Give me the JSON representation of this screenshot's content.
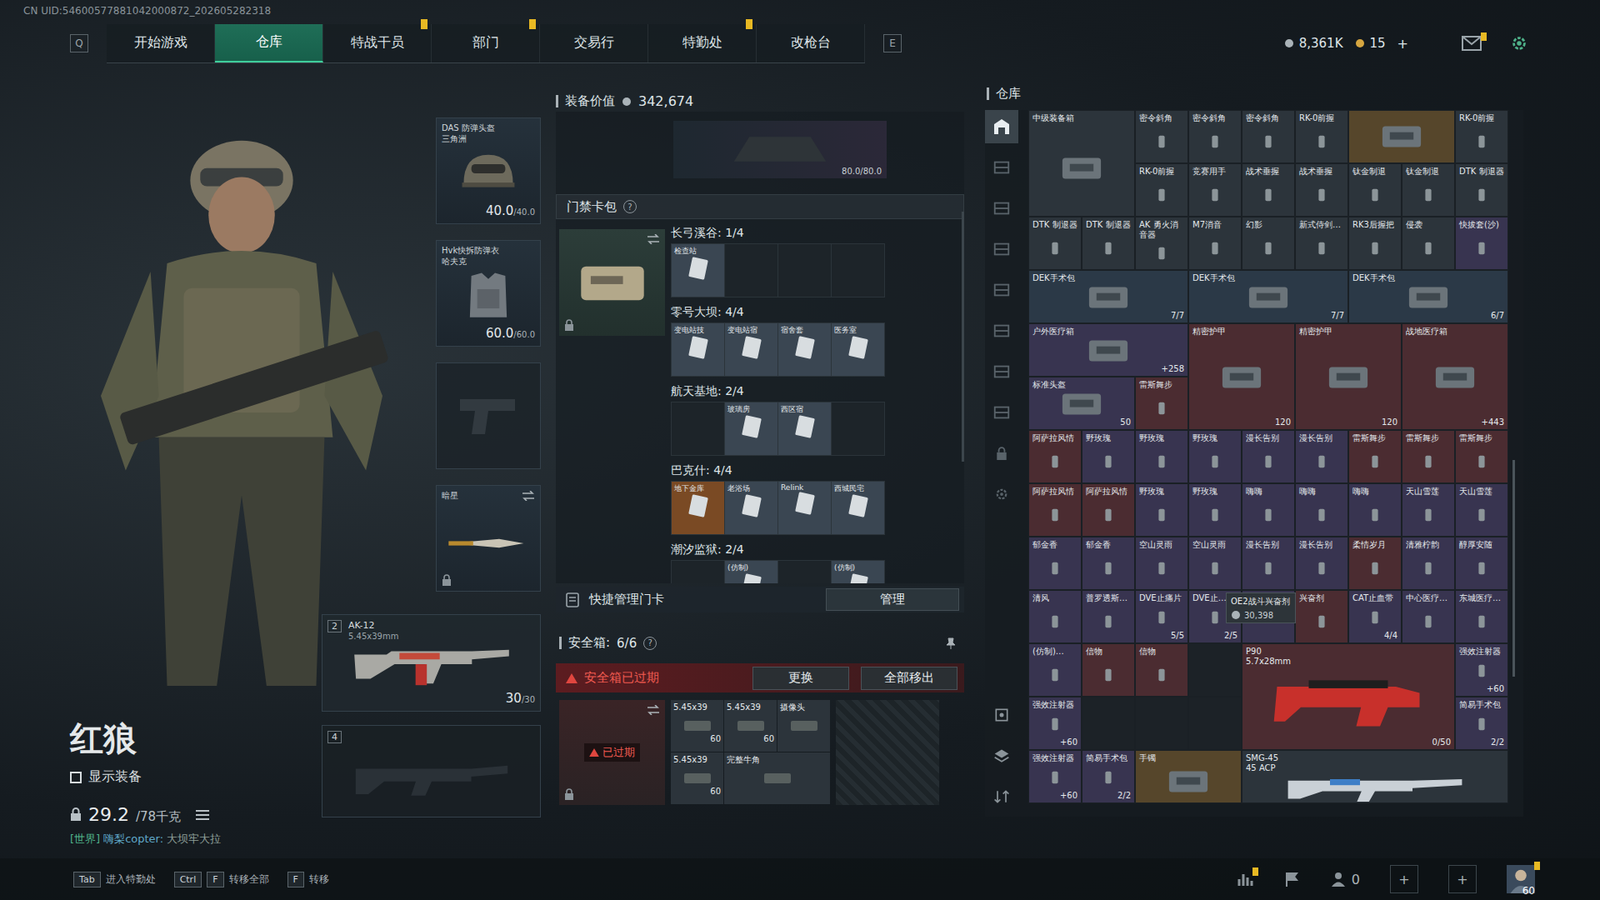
{
  "uid": "CN UID:54600577881042000872_202605282318",
  "nav": {
    "left_key": "Q",
    "right_key": "E",
    "tabs": [
      {
        "label": "开始游戏",
        "selected": false,
        "badge": false
      },
      {
        "label": "仓库",
        "selected": true,
        "badge": false
      },
      {
        "label": "特战干员",
        "selected": false,
        "badge": true
      },
      {
        "label": "部门",
        "selected": false,
        "badge": true
      },
      {
        "label": "交易行",
        "selected": false,
        "badge": false
      },
      {
        "label": "特勤处",
        "selected": false,
        "badge": true
      },
      {
        "label": "改枪台",
        "selected": false,
        "badge": false
      }
    ]
  },
  "currencies": [
    {
      "kind": "silver",
      "value": "8,361K"
    },
    {
      "kind": "gold",
      "value": "15"
    }
  ],
  "currency_add": "+",
  "top_icons": [
    {
      "kind": "mail",
      "badge": true
    },
    {
      "kind": "settings",
      "badge": false
    }
  ],
  "operator": {
    "name": "红狼",
    "show_equipment": {
      "label": "显示装备",
      "checked": false
    },
    "weight": "29.2",
    "weight_max": "/78千克",
    "chat": {
      "channel": "[世界]",
      "user": "嗨梨copter:",
      "message": "大坝牢大拉"
    }
  },
  "equipment": [
    {
      "kind": "helmet",
      "title": "DAS 防弹头盔",
      "subtitle": "三角洲",
      "value": "40.0",
      "max": "/40.0",
      "empty": false,
      "swap": false,
      "locked": false
    },
    {
      "kind": "armor",
      "title": "Hvk快拆防弹衣",
      "subtitle": "哈夫克",
      "value": "60.0",
      "max": "/60.0",
      "empty": false,
      "swap": false,
      "locked": false
    },
    {
      "kind": "pistol",
      "title": "",
      "subtitle": "",
      "value": "",
      "max": "",
      "empty": true,
      "swap": false,
      "locked": false
    },
    {
      "kind": "melee",
      "title": "暗星",
      "subtitle": "",
      "value": "",
      "max": "",
      "empty": false,
      "swap": true,
      "locked": true
    }
  ],
  "weapons": [
    {
      "slot": "2",
      "name": "AK-12",
      "caliber": "5.45x39mm",
      "ammo": "30",
      "ammo_max": "/30",
      "empty": false
    },
    {
      "slot": "4",
      "name": "",
      "caliber": "",
      "ammo": "",
      "ammo_max": "",
      "empty": true
    }
  ],
  "equipment_value": {
    "label": "装备价值",
    "value": "342,674"
  },
  "backpack": {
    "durability": "80.0/80.0"
  },
  "keycards": {
    "title": "门禁卡包",
    "help": "?",
    "groups": [
      {
        "title": "长弓溪谷: 1/4",
        "cards": [
          {
            "name": "检查站",
            "filled": true,
            "color": "#3a4652"
          },
          {
            "name": "",
            "filled": false,
            "color": "#1d2429"
          },
          {
            "name": "",
            "filled": false,
            "color": "#1d2429"
          },
          {
            "name": "",
            "filled": false,
            "color": "#1d2429"
          }
        ]
      },
      {
        "title": "零号大坝: 4/4",
        "cards": [
          {
            "name": "变电站技",
            "filled": true,
            "color": "#3a4652"
          },
          {
            "name": "变电站宿",
            "filled": true,
            "color": "#3a4652"
          },
          {
            "name": "宿舍套",
            "filled": true,
            "color": "#3a4652"
          },
          {
            "name": "医务室",
            "filled": true,
            "color": "#3a4652"
          }
        ]
      },
      {
        "title": "航天基地: 2/4",
        "cards": [
          {
            "name": "",
            "filled": false,
            "color": "#1d2429"
          },
          {
            "name": "玻璃房",
            "filled": true,
            "color": "#3a4652"
          },
          {
            "name": "西区宿",
            "filled": true,
            "color": "#3a4652"
          },
          {
            "name": "",
            "filled": false,
            "color": "#1d2429"
          }
        ]
      },
      {
        "title": "巴克什: 4/4",
        "cards": [
          {
            "name": "地下金库",
            "filled": true,
            "color": "#7a4a24"
          },
          {
            "name": "老浴场",
            "filled": true,
            "color": "#3a4652"
          },
          {
            "name": "Relink",
            "filled": true,
            "color": "#3a4652"
          },
          {
            "name": "西城民宅",
            "filled": true,
            "color": "#3a4652"
          }
        ]
      },
      {
        "title": "潮汐监狱: 2/4",
        "cards": [
          {
            "name": "",
            "filled": false,
            "color": "#1d2429"
          },
          {
            "name": "(仿制)",
            "filled": true,
            "color": "#3a4652"
          },
          {
            "name": "",
            "filled": false,
            "color": "#1d2429"
          },
          {
            "name": "(仿制)",
            "filled": true,
            "color": "#3a4652"
          }
        ]
      }
    ]
  },
  "quick_manage": {
    "label": "快捷管理门卡",
    "button": "管理"
  },
  "safebox": {
    "title": "安全箱:",
    "count": "6/6",
    "help": "?",
    "warning": "安全箱已过期",
    "buttons": [
      "更换",
      "全部移出"
    ],
    "expired_label": "已过期",
    "items": [
      {
        "name": "5.45x39",
        "count": "60",
        "kind": "cell"
      },
      {
        "name": "5.45x39",
        "count": "60",
        "kind": "cell"
      },
      {
        "name": "摄像头",
        "count": "",
        "kind": "cell"
      },
      {
        "name": "5.45x39",
        "count": "60",
        "kind": "cell"
      },
      {
        "name": "完整牛角",
        "count": "",
        "kind": "wide"
      }
    ]
  },
  "warehouse": {
    "title": "仓库",
    "sidebar": [
      {
        "kind": "all",
        "selected": true
      },
      {
        "kind": "rack",
        "selected": false
      },
      {
        "kind": "rack",
        "selected": false
      },
      {
        "kind": "rack",
        "selected": false
      },
      {
        "kind": "rack",
        "selected": false
      },
      {
        "kind": "rack",
        "selected": false
      },
      {
        "kind": "rack",
        "selected": false
      },
      {
        "kind": "rack",
        "selected": false
      },
      {
        "kind": "lock",
        "selected": false
      },
      {
        "kind": "gear",
        "selected": false
      }
    ],
    "sidebar_bottom": [
      {
        "kind": "box"
      },
      {
        "kind": "layers"
      },
      {
        "kind": "sort"
      }
    ],
    "tooltip": {
      "name": "OE2战斗兴奋剂",
      "price": "30,398"
    },
    "items": [
      {
        "name": "中级装备箱",
        "sub": "",
        "count": "",
        "kind": "crate",
        "color": "#2c343b"
      },
      {
        "name": "密令斜角",
        "sub": "",
        "count": "",
        "kind": "cell",
        "color": "#2c343b"
      },
      {
        "name": "密令斜角",
        "sub": "",
        "count": "",
        "kind": "cell",
        "color": "#2c343b"
      },
      {
        "name": "密令斜角",
        "sub": "",
        "count": "",
        "kind": "cell",
        "color": "#2c343b"
      },
      {
        "name": "RK-0前握",
        "sub": "",
        "count": "",
        "kind": "cell",
        "color": "#2c343b"
      },
      {
        "name": "",
        "sub": "",
        "count": "",
        "kind": "wide",
        "color": "#56462b"
      },
      {
        "name": "RK-0前握",
        "sub": "",
        "count": "",
        "kind": "cell",
        "color": "#2c343b"
      },
      {
        "name": "RK-0前握",
        "sub": "",
        "count": "",
        "kind": "cell",
        "color": "#2c343b"
      },
      {
        "name": "竞赛用手",
        "sub": "",
        "count": "",
        "kind": "cell",
        "color": "#2c343b"
      },
      {
        "name": "战术垂握",
        "sub": "",
        "count": "",
        "kind": "cell",
        "color": "#2c343b"
      },
      {
        "name": "战术垂握",
        "sub": "",
        "count": "",
        "kind": "cell",
        "color": "#2c343b"
      },
      {
        "name": "钛金制退",
        "sub": "",
        "count": "",
        "kind": "cell",
        "color": "#2c343b"
      },
      {
        "name": "钛金制退",
        "sub": "",
        "count": "",
        "kind": "cell",
        "color": "#2c343b"
      },
      {
        "name": "DTK 制退器",
        "sub": "",
        "count": "",
        "kind": "cell",
        "color": "#2c343b"
      },
      {
        "name": "DTK 制退器",
        "sub": "",
        "count": "",
        "kind": "cell",
        "color": "#2c343b"
      },
      {
        "name": "DTK 制退器",
        "sub": "",
        "count": "",
        "kind": "cell",
        "color": "#2c343b"
      },
      {
        "name": "AK 勇火消音器",
        "sub": "",
        "count": "",
        "kind": "cell",
        "color": "#2c343b"
      },
      {
        "name": "M7消音",
        "sub": "",
        "count": "",
        "kind": "cell",
        "color": "#2c343b"
      },
      {
        "name": "幻影",
        "sub": "",
        "count": "",
        "kind": "cell",
        "color": "#2c343b"
      },
      {
        "name": "新式侍剑…",
        "sub": "",
        "count": "",
        "kind": "cell",
        "color": "#2c343b"
      },
      {
        "name": "RK3后握把",
        "sub": "",
        "count": "",
        "kind": "cell",
        "color": "#2c343b"
      },
      {
        "name": "侵袭",
        "sub": "",
        "count": "",
        "kind": "cell",
        "color": "#2c343b"
      },
      {
        "name": "快拔套(沙)",
        "sub": "",
        "count": "",
        "kind": "cell",
        "color": "#383450"
      },
      {
        "name": "DEK手术包",
        "sub": "",
        "count": "7/7",
        "kind": "long",
        "color": "#2b3947"
      },
      {
        "name": "DEK手术包",
        "sub": "",
        "count": "7/7",
        "kind": "long",
        "color": "#2b3947"
      },
      {
        "name": "DEK手术包",
        "sub": "",
        "count": "6/7",
        "kind": "long",
        "color": "#2b3947"
      },
      {
        "name": "户外医疗箱",
        "sub": "",
        "count": "+258",
        "kind": "long",
        "color": "#383450"
      },
      {
        "name": "精密护甲",
        "sub": "",
        "count": "120",
        "kind": "crate",
        "color": "#4b2c31"
      },
      {
        "name": "精密护甲",
        "sub": "",
        "count": "120",
        "kind": "crate",
        "color": "#4b2c31"
      },
      {
        "name": "战地医疗箱",
        "sub": "",
        "count": "+443",
        "kind": "crate",
        "color": "#4b2c31"
      },
      {
        "name": "标准头盔",
        "sub": "",
        "count": "50",
        "kind": "wide",
        "color": "#383450"
      },
      {
        "name": "雷斯舞步",
        "sub": "",
        "count": "",
        "kind": "cell",
        "color": "#4b2c31"
      },
      {
        "name": "阿萨拉风情",
        "sub": "",
        "count": "",
        "kind": "cell",
        "color": "#4b2c31"
      },
      {
        "name": "野玫瑰",
        "sub": "",
        "count": "",
        "kind": "cell",
        "color": "#383450"
      },
      {
        "name": "野玫瑰",
        "sub": "",
        "count": "",
        "kind": "cell",
        "color": "#383450"
      },
      {
        "name": "野玫瑰",
        "sub": "",
        "count": "",
        "kind": "cell",
        "color": "#383450"
      },
      {
        "name": "漫长告别",
        "sub": "",
        "count": "",
        "kind": "cell",
        "color": "#383450"
      },
      {
        "name": "漫长告别",
        "sub": "",
        "count": "",
        "kind": "cell",
        "color": "#383450"
      },
      {
        "name": "雷斯舞步",
        "sub": "",
        "count": "",
        "kind": "cell",
        "color": "#4b2c31"
      },
      {
        "name": "雷斯舞步",
        "sub": "",
        "count": "",
        "kind": "cell",
        "color": "#4b2c31"
      },
      {
        "name": "雷斯舞步",
        "sub": "",
        "count": "",
        "kind": "cell",
        "color": "#4b2c31"
      },
      {
        "name": "阿萨拉风情",
        "sub": "",
        "count": "",
        "kind": "cell",
        "color": "#4b2c31"
      },
      {
        "name": "阿萨拉风情",
        "sub": "",
        "count": "",
        "kind": "cell",
        "color": "#4b2c31"
      },
      {
        "name": "野玫瑰",
        "sub": "",
        "count": "",
        "kind": "cell",
        "color": "#383450"
      },
      {
        "name": "野玫瑰",
        "sub": "",
        "count": "",
        "kind": "cell",
        "color": "#383450"
      },
      {
        "name": "嗨嗨",
        "sub": "",
        "count": "",
        "kind": "cell",
        "color": "#383450"
      },
      {
        "name": "嗨嗨",
        "sub": "",
        "count": "",
        "kind": "cell",
        "color": "#383450"
      },
      {
        "name": "嗨嗨",
        "sub": "",
        "count": "",
        "kind": "cell",
        "color": "#383450"
      },
      {
        "name": "天山雪莲",
        "sub": "",
        "count": "",
        "kind": "cell",
        "color": "#383450"
      },
      {
        "name": "天山雪莲",
        "sub": "",
        "count": "",
        "kind": "cell",
        "color": "#383450"
      },
      {
        "name": "郁金香",
        "sub": "",
        "count": "",
        "kind": "cell",
        "color": "#383450"
      },
      {
        "name": "郁金香",
        "sub": "",
        "count": "",
        "kind": "cell",
        "color": "#383450"
      },
      {
        "name": "空山灵雨",
        "sub": "",
        "count": "",
        "kind": "cell",
        "color": "#383450"
      },
      {
        "name": "空山灵雨",
        "sub": "",
        "count": "",
        "kind": "cell",
        "color": "#383450"
      },
      {
        "name": "漫长告别",
        "sub": "",
        "count": "",
        "kind": "cell",
        "color": "#383450"
      },
      {
        "name": "漫长告别",
        "sub": "",
        "count": "",
        "kind": "cell",
        "color": "#383450"
      },
      {
        "name": "柔情岁月",
        "sub": "",
        "count": "",
        "kind": "cell",
        "color": "#4b2c31"
      },
      {
        "name": "清雅柠韵",
        "sub": "",
        "count": "",
        "kind": "cell",
        "color": "#383450"
      },
      {
        "name": "醇厚安随",
        "sub": "",
        "count": "",
        "kind": "cell",
        "color": "#383450"
      },
      {
        "name": "清风",
        "sub": "",
        "count": "",
        "kind": "cell",
        "color": "#383450"
      },
      {
        "name": "普罗透斯…",
        "sub": "",
        "count": "",
        "kind": "cell",
        "color": "#383450"
      },
      {
        "name": "DVE止痛片",
        "sub": "",
        "count": "5/5",
        "kind": "cell",
        "color": "#383450"
      },
      {
        "name": "DVE止…",
        "sub": "",
        "count": "2/5",
        "kind": "cell",
        "color": "#383450"
      },
      {
        "name": "",
        "sub": "",
        "count": "",
        "kind": "cell",
        "color": "#383450"
      },
      {
        "name": "兴奋剂",
        "sub": "",
        "count": "",
        "kind": "cell",
        "color": "#4b2c31"
      },
      {
        "name": "CAT止血带",
        "sub": "",
        "count": "4/4",
        "kind": "cell",
        "color": "#383450"
      },
      {
        "name": "中心医疗…",
        "sub": "",
        "count": "",
        "kind": "cell",
        "color": "#383450"
      },
      {
        "name": "东城医疗…",
        "sub": "",
        "count": "",
        "kind": "cell",
        "color": "#383450"
      },
      {
        "name": "(仿制)…",
        "sub": "",
        "count": "",
        "kind": "cell",
        "color": "#383450"
      },
      {
        "name": "信物",
        "sub": "",
        "count": "",
        "kind": "cell",
        "color": "#4b2c31"
      },
      {
        "name": "信物",
        "sub": "",
        "count": "",
        "kind": "cell",
        "color": "#4b2c31"
      },
      {
        "name": "",
        "sub": "",
        "count": "",
        "kind": "empty",
        "color": "#1c2227"
      },
      {
        "name": "P90",
        "sub": "5.7x28mm",
        "count": "0/50",
        "kind": "gun",
        "color": "#4b2c31"
      },
      {
        "name": "强效注射器",
        "sub": "",
        "count": "+60",
        "kind": "cell",
        "color": "#383450"
      },
      {
        "name": "强效注射器",
        "sub": "",
        "count": "+60",
        "kind": "cell",
        "color": "#383450"
      },
      {
        "name": "",
        "sub": "",
        "count": "",
        "kind": "empty",
        "color": "#1c2227"
      },
      {
        "name": "",
        "sub": "",
        "count": "",
        "kind": "empty",
        "color": "#1c2227"
      },
      {
        "name": "",
        "sub": "",
        "count": "",
        "kind": "empty",
        "color": "#1c2227"
      },
      {
        "name": "简易手术包",
        "sub": "",
        "count": "2/2",
        "kind": "cell",
        "color": "#383450"
      },
      {
        "name": "强效注射器",
        "sub": "",
        "count": "+60",
        "kind": "cell",
        "color": "#383450"
      },
      {
        "name": "简易手术包",
        "sub": "",
        "count": "2/2",
        "kind": "cell",
        "color": "#383450"
      },
      {
        "name": "手镯",
        "sub": "",
        "count": "",
        "kind": "wide",
        "color": "#56462b"
      },
      {
        "name": "SMG-45",
        "sub": "45 ACP",
        "count": "",
        "kind": "rifle",
        "color": "#2c343b"
      }
    ]
  },
  "bottom": {
    "hints": [
      {
        "keys": [
          "Tab"
        ],
        "label": "进入特勤处"
      },
      {
        "keys": [
          "Ctrl",
          "F"
        ],
        "label": "转移全部"
      },
      {
        "keys": [
          "F"
        ],
        "label": "转移"
      }
    ],
    "icons": [
      {
        "kind": "stats",
        "badge": true,
        "text": ""
      },
      {
        "kind": "flag",
        "badge": false,
        "text": ""
      },
      {
        "kind": "friends",
        "badge": false,
        "text": "0"
      },
      {
        "kind": "add",
        "badge": false,
        "text": "+"
      },
      {
        "kind": "add",
        "badge": false,
        "text": "+"
      },
      {
        "kind": "avatar",
        "badge": true,
        "text": "60"
      }
    ]
  }
}
